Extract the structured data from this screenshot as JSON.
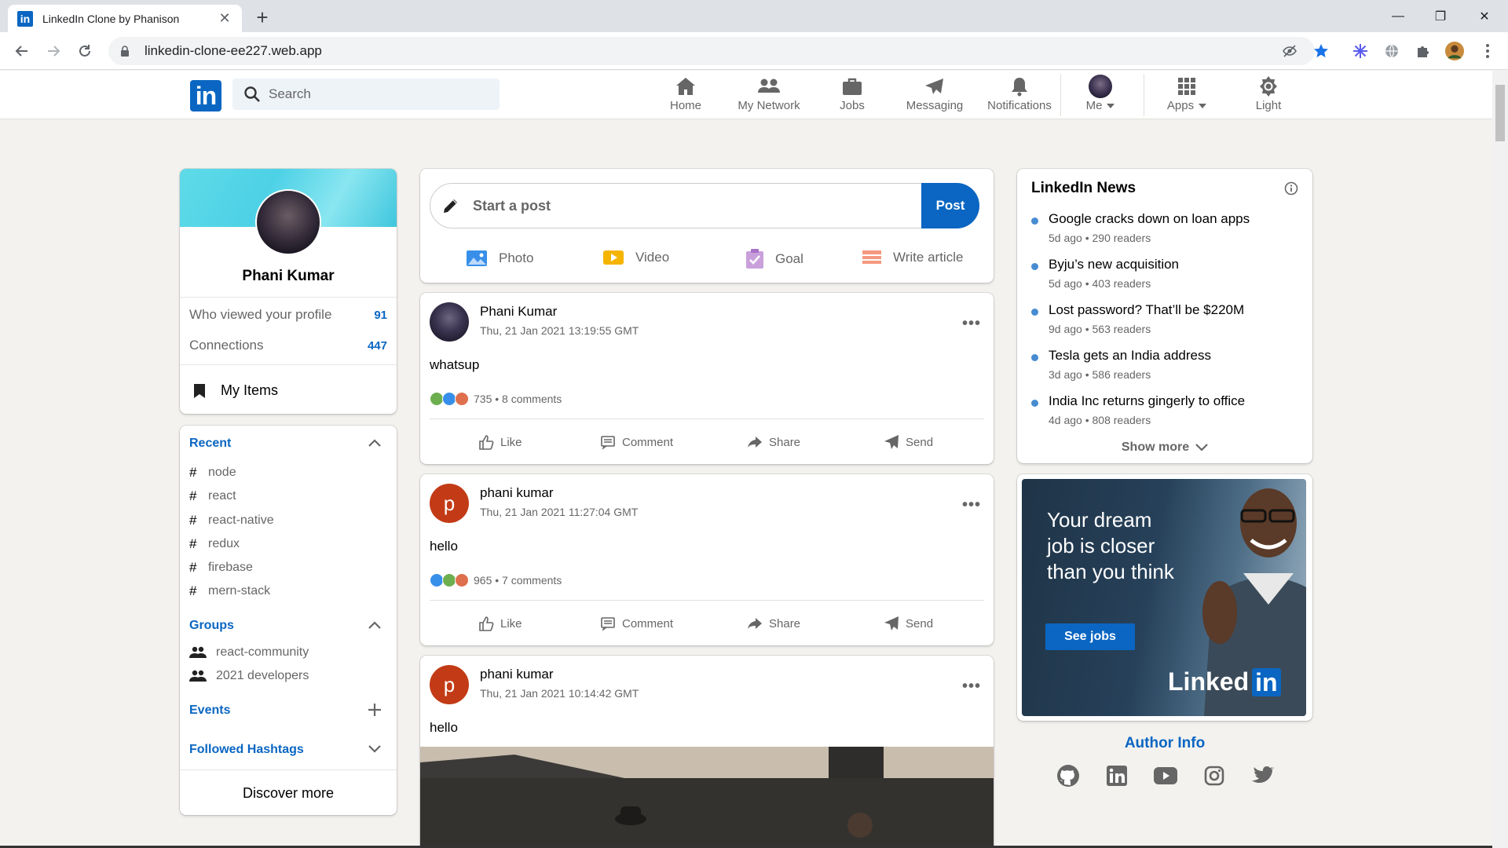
{
  "browser": {
    "tab_title": "LinkedIn Clone by Phanison",
    "tab_favicon_text": "in",
    "url": "linkedin-clone-ee227.web.app",
    "close_glyph": "✕",
    "newtab_glyph": "+",
    "minimize_glyph": "—",
    "maximize_glyph": "❐",
    "win_close_glyph": "✕"
  },
  "header": {
    "logo_text": "in",
    "search_placeholder": "Search",
    "nav": [
      {
        "label": "Home",
        "icon": "home-icon"
      },
      {
        "label": "My Network",
        "icon": "network-icon"
      },
      {
        "label": "Jobs",
        "icon": "briefcase-icon"
      },
      {
        "label": "Messaging",
        "icon": "paper-plane-icon"
      },
      {
        "label": "Notifications",
        "icon": "bell-icon"
      },
      {
        "label": "Me",
        "icon": "avatar"
      },
      {
        "label": "Apps",
        "icon": "grid-icon"
      },
      {
        "label": "Light",
        "icon": "brightness-icon"
      }
    ]
  },
  "profile": {
    "name": "Phani Kumar",
    "stats": [
      {
        "label": "Who viewed your profile",
        "value": "91"
      },
      {
        "label": "Connections",
        "value": "447"
      }
    ],
    "my_items": "My Items"
  },
  "sidebar": {
    "recent_title": "Recent",
    "recent": [
      "node",
      "react",
      "react-native",
      "redux",
      "firebase",
      "mern-stack"
    ],
    "groups_title": "Groups",
    "groups": [
      "react-community",
      "2021 developers"
    ],
    "events_title": "Events",
    "hashtags_title": "Followed Hashtags",
    "discover": "Discover more",
    "hash_glyph": "#"
  },
  "composer": {
    "placeholder": "Start a post",
    "post_button": "Post",
    "options": [
      {
        "label": "Photo",
        "icon": "photo-icon",
        "color": "#378fe9"
      },
      {
        "label": "Video",
        "icon": "video-icon",
        "color": "#f5b400"
      },
      {
        "label": "Goal",
        "icon": "goal-icon",
        "color": "#c37d16"
      },
      {
        "label": "Write article",
        "icon": "article-icon",
        "color": "#e16745"
      }
    ]
  },
  "posts": [
    {
      "author": "Phani Kumar",
      "time": "Thu, 21 Jan 2021 13:19:55 GMT",
      "text": "whatsup",
      "reactions": "735 • 8 comments",
      "avatar": "photo"
    },
    {
      "author": "phani kumar",
      "time": "Thu, 21 Jan 2021 11:27:04 GMT",
      "text": "hello",
      "reactions": "965 • 7 comments",
      "avatar": "p"
    },
    {
      "author": "phani kumar",
      "time": "Thu, 21 Jan 2021 10:14:42 GMT",
      "text": "hello",
      "avatar": "p"
    }
  ],
  "post_actions": {
    "like": "Like",
    "comment": "Comment",
    "share": "Share",
    "send": "Send",
    "more": "•••"
  },
  "news": {
    "title": "LinkedIn News",
    "items": [
      {
        "headline": "Google cracks down on loan apps",
        "meta": "5d ago • 290 readers"
      },
      {
        "headline": "Byju’s new acquisition",
        "meta": "5d ago • 403 readers"
      },
      {
        "headline": "Lost password? That’ll be $220M",
        "meta": "9d ago • 563 readers"
      },
      {
        "headline": "Tesla gets an India address",
        "meta": "3d ago • 586 readers"
      },
      {
        "headline": "India Inc returns gingerly to office",
        "meta": "4d ago • 808 readers"
      }
    ],
    "show_more": "Show more"
  },
  "ad": {
    "text": "Your dream job is closer than you think",
    "button": "See jobs",
    "brand": "Linked",
    "brand_in": "in"
  },
  "author": {
    "title": "Author Info",
    "links": [
      "github-icon",
      "linkedin-icon",
      "youtube-icon",
      "instagram-icon",
      "twitter-icon"
    ]
  },
  "colors": {
    "brand": "#0a66c2",
    "page_bg": "#f3f2ef",
    "post_avatar_p": "#c23b16"
  }
}
